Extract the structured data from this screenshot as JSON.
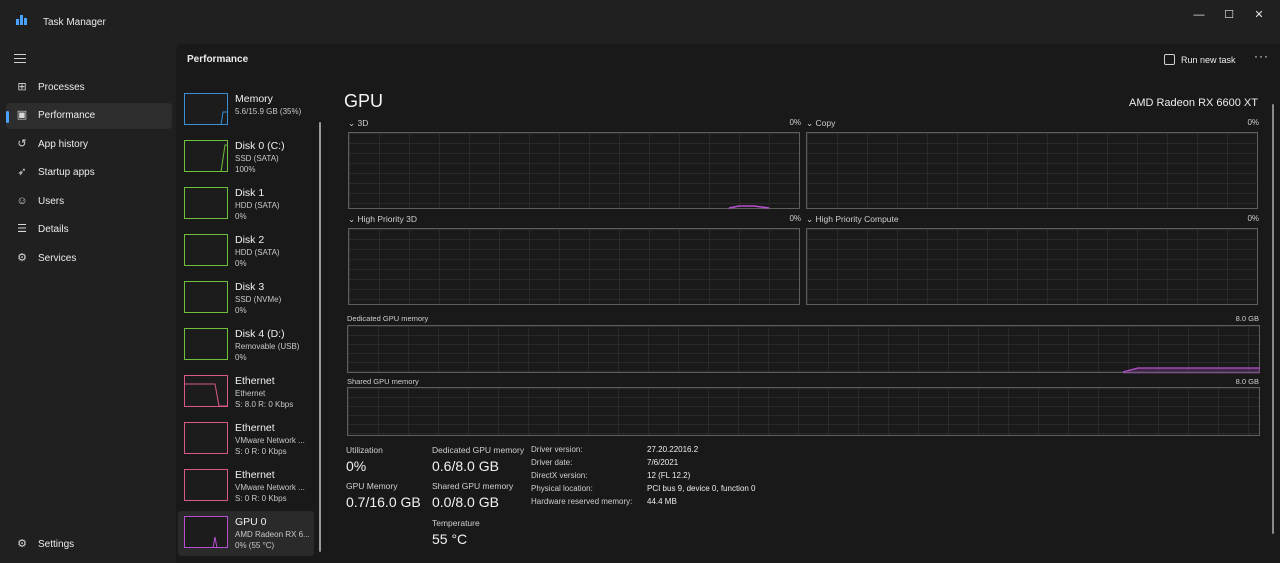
{
  "app": {
    "title": "Task Manager"
  },
  "window_buttons": {
    "minimize": "—",
    "maximize": "☐",
    "close": "✕"
  },
  "nav": {
    "items": [
      {
        "label": "Processes",
        "icon": "processes-icon",
        "glyph": "⊞"
      },
      {
        "label": "Performance",
        "icon": "performance-icon",
        "glyph": "▣",
        "active": true
      },
      {
        "label": "App history",
        "icon": "history-icon",
        "glyph": "↺"
      },
      {
        "label": "Startup apps",
        "icon": "startup-icon",
        "glyph": "➶"
      },
      {
        "label": "Users",
        "icon": "users-icon",
        "glyph": "☺"
      },
      {
        "label": "Details",
        "icon": "details-icon",
        "glyph": "☰"
      },
      {
        "label": "Services",
        "icon": "services-icon",
        "glyph": "⚙"
      }
    ],
    "settings": {
      "label": "Settings",
      "icon": "settings-icon",
      "glyph": "⚙"
    }
  },
  "header": {
    "title": "Performance",
    "run_new_task": "Run new task",
    "more": "···"
  },
  "devices": [
    {
      "name": "Memory",
      "sub1": "5.6/15.9 GB (35%)",
      "sub2": "",
      "color": "#3b8fd6"
    },
    {
      "name": "Disk 0 (C:)",
      "sub1": "SSD (SATA)",
      "sub2": "100%",
      "color": "#6fbf3a"
    },
    {
      "name": "Disk 1",
      "sub1": "HDD (SATA)",
      "sub2": "0%",
      "color": "#6fbf3a"
    },
    {
      "name": "Disk 2",
      "sub1": "HDD (SATA)",
      "sub2": "0%",
      "color": "#6fbf3a"
    },
    {
      "name": "Disk 3",
      "sub1": "SSD (NVMe)",
      "sub2": "0%",
      "color": "#6fbf3a"
    },
    {
      "name": "Disk 4 (D:)",
      "sub1": "Removable (USB)",
      "sub2": "0%",
      "color": "#6fbf3a"
    },
    {
      "name": "Ethernet",
      "sub1": "Ethernet",
      "sub2": "S: 8.0 R: 0 Kbps",
      "color": "#d9588c"
    },
    {
      "name": "Ethernet",
      "sub1": "VMware Network ...",
      "sub2": "S: 0 R: 0 Kbps",
      "color": "#d9588c"
    },
    {
      "name": "Ethernet",
      "sub1": "VMware Network ...",
      "sub2": "S: 0 R: 0 Kbps",
      "color": "#d9588c"
    },
    {
      "name": "GPU 0",
      "sub1": "AMD Radeon RX 6...",
      "sub2": "0% (55 °C)",
      "color": "#b84fd0",
      "selected": true
    }
  ],
  "gpu": {
    "title": "GPU",
    "model": "AMD Radeon RX 6600 XT",
    "engines": [
      {
        "label": "3D",
        "value": "0%"
      },
      {
        "label": "Copy",
        "value": "0%"
      },
      {
        "label": "High Priority 3D",
        "value": "0%"
      },
      {
        "label": "High Priority Compute",
        "value": "0%"
      }
    ],
    "dedicated_graph": {
      "label": "Dedicated GPU memory",
      "max": "8.0 GB"
    },
    "shared_graph": {
      "label": "Shared GPU memory",
      "max": "8.0 GB"
    },
    "accent": "#b84fd0",
    "stats": {
      "utilization_label": "Utilization",
      "utilization": "0%",
      "gpu_memory_label": "GPU Memory",
      "gpu_memory": "0.7/16.0 GB",
      "dedicated_label": "Dedicated GPU memory",
      "dedicated": "0.6/8.0 GB",
      "shared_label": "Shared GPU memory",
      "shared": "0.0/8.0 GB",
      "temperature_label": "Temperature",
      "temperature": "55 °C"
    },
    "info": [
      {
        "key": "Driver version:",
        "value": "27.20.22016.2"
      },
      {
        "key": "Driver date:",
        "value": "7/6/2021"
      },
      {
        "key": "DirectX version:",
        "value": "12 (FL 12.2)"
      },
      {
        "key": "Physical location:",
        "value": "PCI bus 9, device 0, function 0"
      },
      {
        "key": "Hardware reserved memory:",
        "value": "44.4 MB"
      }
    ]
  }
}
